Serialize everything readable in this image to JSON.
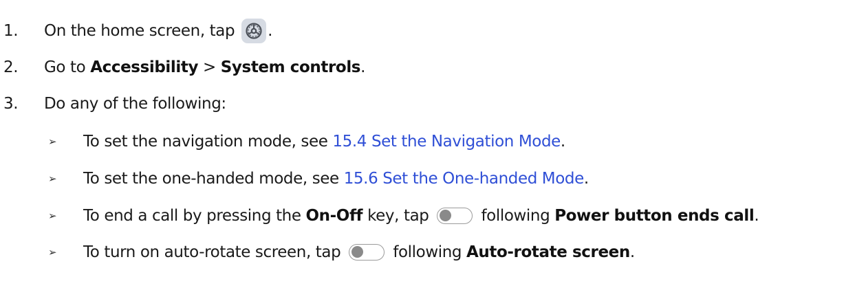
{
  "steps": [
    {
      "num": "1.",
      "prefix": "On the home screen, tap",
      "suffix": ".",
      "icon": "settings-gear-icon"
    },
    {
      "num": "2.",
      "prefix": "Go to ",
      "strong1": "Accessibility",
      "sep": " > ",
      "strong2": "System controls",
      "suffix": "."
    },
    {
      "num": "3.",
      "text": "Do any of the following:"
    }
  ],
  "bullet_symbol": "➢",
  "subitems": [
    {
      "prefix": "To set the navigation mode, see ",
      "link": "15.4 Set the Navigation Mode",
      "suffix": "."
    },
    {
      "prefix": "To set the one-handed mode, see ",
      "link": "15.6 Set the One-handed Mode",
      "suffix": "."
    },
    {
      "prefix": "To end a call by pressing the ",
      "strong": "On-Off",
      "mid": " key, tap",
      "after_toggle": "following ",
      "strong2": "Power button ends call",
      "suffix": "."
    },
    {
      "prefix": "To turn on auto-rotate screen, tap",
      "after_toggle": "following ",
      "strong2": "Auto-rotate screen",
      "suffix": "."
    }
  ],
  "colors": {
    "link": "#2f4fd6",
    "toggle_knob": "#8a8a8a",
    "icon_bg": "#d6dbe3"
  }
}
